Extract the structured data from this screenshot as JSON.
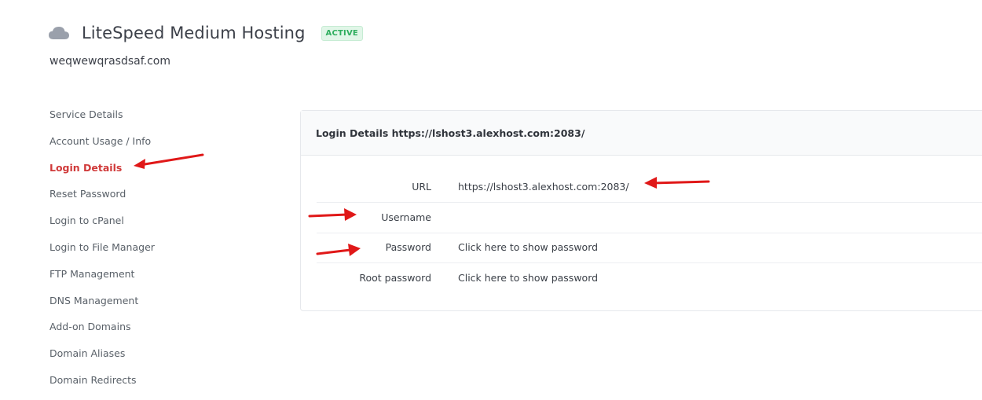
{
  "product": {
    "title": "LiteSpeed Medium Hosting",
    "status": "ACTIVE",
    "domain": "weqwewqrasdsaf.com",
    "icon": "cloud-icon"
  },
  "sidebar": {
    "items": [
      {
        "label": "Service Details"
      },
      {
        "label": "Account Usage / Info"
      },
      {
        "label": "Login Details",
        "active": true
      },
      {
        "label": "Reset Password"
      },
      {
        "label": "Login to cPanel"
      },
      {
        "label": "Login to File Manager"
      },
      {
        "label": "FTP Management"
      },
      {
        "label": "DNS Management"
      },
      {
        "label": "Add-on Domains"
      },
      {
        "label": "Domain Aliases"
      },
      {
        "label": "Domain Redirects"
      }
    ]
  },
  "panel": {
    "title": "Login Details https://lshost3.alexhost.com:2083/",
    "rows": [
      {
        "label": "URL",
        "value": "https://lshost3.alexhost.com:2083/"
      },
      {
        "label": "Username",
        "value": ""
      },
      {
        "label": "Password",
        "value": "Click here to show password"
      },
      {
        "label": "Root password",
        "value": "Click here to show password"
      }
    ]
  },
  "colors": {
    "active_link": "#d03a3a",
    "badge_text": "#2fae5e",
    "badge_bg": "#e1f6e8",
    "annotation_arrow": "#e01818"
  }
}
